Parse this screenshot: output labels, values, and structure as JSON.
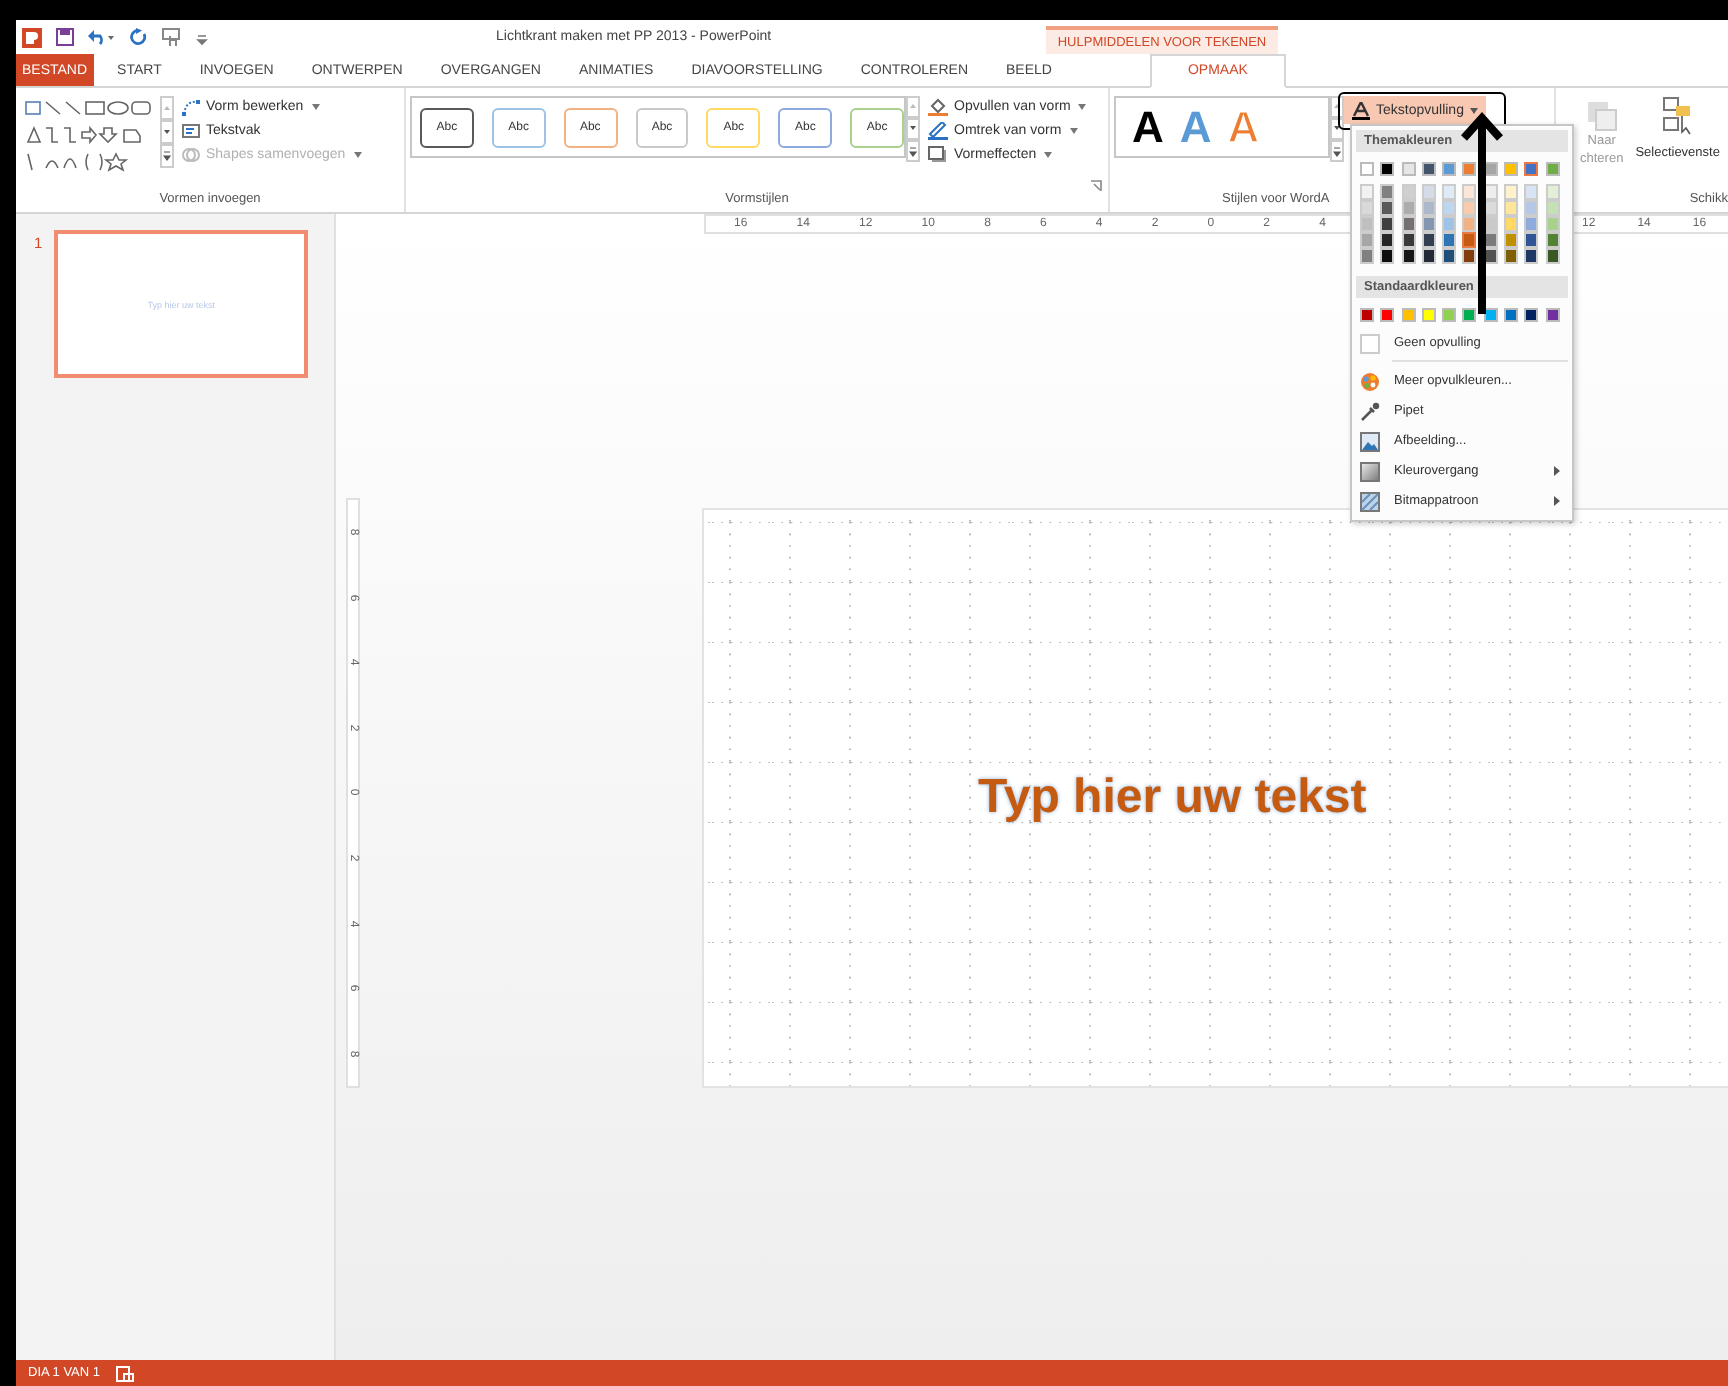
{
  "title_bar": {
    "title": "Lichtkrant maken met PP 2013 - PowerPoint",
    "contextual_header": "HULPMIDDELEN VOOR TEKENEN"
  },
  "tabs": [
    {
      "label": "BESTAND",
      "kind": "file",
      "selected": false
    },
    {
      "label": "START",
      "kind": "normal",
      "selected": false
    },
    {
      "label": "INVOEGEN",
      "kind": "normal",
      "selected": false
    },
    {
      "label": "ONTWERPEN",
      "kind": "normal",
      "selected": false
    },
    {
      "label": "OVERGANGEN",
      "kind": "normal",
      "selected": false
    },
    {
      "label": "ANIMATIES",
      "kind": "normal",
      "selected": false
    },
    {
      "label": "DIAVOORSTELLING",
      "kind": "normal",
      "selected": false
    },
    {
      "label": "CONTROLEREN",
      "kind": "normal",
      "selected": false
    },
    {
      "label": "BEELD",
      "kind": "normal",
      "selected": false
    },
    {
      "label": "OPMAAK",
      "kind": "contextual",
      "selected": true
    }
  ],
  "insert_shapes": {
    "label": "Vormen invoegen",
    "commands": [
      {
        "label": "Vorm bewerken",
        "dropdown": true,
        "disabled": false
      },
      {
        "label": "Tekstvak",
        "dropdown": false,
        "disabled": false
      },
      {
        "label": "Shapes samenvoegen",
        "dropdown": true,
        "disabled": true
      }
    ]
  },
  "shape_styles": {
    "label": "Vormstijlen",
    "styles": [
      {
        "label": "Abc",
        "color": "#595959"
      },
      {
        "label": "Abc",
        "color": "#9dc3e6"
      },
      {
        "label": "Abc",
        "color": "#f4b183"
      },
      {
        "label": "Abc",
        "color": "#c9c9c9"
      },
      {
        "label": "Abc",
        "color": "#ffd966"
      },
      {
        "label": "Abc",
        "color": "#8faadc"
      },
      {
        "label": "Abc",
        "color": "#a9d18e"
      }
    ],
    "commands": [
      {
        "label": "Opvullen van vorm",
        "dropdown": true
      },
      {
        "label": "Omtrek van vorm",
        "dropdown": true
      },
      {
        "label": "Vormeffecten",
        "dropdown": true
      }
    ]
  },
  "wordart_styles": {
    "label": "Stijlen voor WordA",
    "styles": [
      {
        "label": "A",
        "kind": "solid",
        "color": "#000000"
      },
      {
        "label": "A",
        "kind": "solid",
        "color": "#5b9bd5"
      },
      {
        "label": "A",
        "kind": "outline",
        "color": "#ed7d31"
      }
    ],
    "text_fill": {
      "label": "Tekstopvulling",
      "pressed": true,
      "highlighted": true
    }
  },
  "arrange": {
    "label": "Schikk",
    "send_backward": {
      "top": "Naar",
      "bottom": "chteren"
    },
    "selection_pane": {
      "label": "Selectievenste"
    }
  },
  "fill_menu": {
    "theme_heading": "Themakleuren",
    "theme_colors": [
      {
        "color": "#ffffff",
        "selected": false,
        "shades": [
          {
            "color": "#f2f2f2",
            "selected": false
          },
          {
            "color": "#d9d9d9",
            "selected": false
          },
          {
            "color": "#bfbfbf",
            "selected": false
          },
          {
            "color": "#a6a6a6",
            "selected": false
          },
          {
            "color": "#808080",
            "selected": false
          }
        ]
      },
      {
        "color": "#000000",
        "selected": false,
        "shades": [
          {
            "color": "#808080",
            "selected": false
          },
          {
            "color": "#595959",
            "selected": false
          },
          {
            "color": "#404040",
            "selected": false
          },
          {
            "color": "#262626",
            "selected": false
          },
          {
            "color": "#0d0d0d",
            "selected": false
          }
        ]
      },
      {
        "color": "#e7e6e6",
        "selected": false,
        "shades": [
          {
            "color": "#d0cece",
            "selected": false
          },
          {
            "color": "#aeabab",
            "selected": false
          },
          {
            "color": "#757070",
            "selected": false
          },
          {
            "color": "#3b3838",
            "selected": false
          },
          {
            "color": "#171616",
            "selected": false
          }
        ]
      },
      {
        "color": "#44546a",
        "selected": false,
        "shades": [
          {
            "color": "#d6dce5",
            "selected": false
          },
          {
            "color": "#adb9ca",
            "selected": false
          },
          {
            "color": "#8497b0",
            "selected": false
          },
          {
            "color": "#333f50",
            "selected": false
          },
          {
            "color": "#222a35",
            "selected": false
          }
        ]
      },
      {
        "color": "#5b9bd5",
        "selected": false,
        "shades": [
          {
            "color": "#deebf7",
            "selected": false
          },
          {
            "color": "#bdd7ee",
            "selected": false
          },
          {
            "color": "#9dc3e6",
            "selected": false
          },
          {
            "color": "#2e75b6",
            "selected": false
          },
          {
            "color": "#1f4e79",
            "selected": false
          }
        ]
      },
      {
        "color": "#ed7d31",
        "selected": false,
        "shades": [
          {
            "color": "#fbe5d6",
            "selected": false
          },
          {
            "color": "#f8cbad",
            "selected": false
          },
          {
            "color": "#f4b183",
            "selected": false
          },
          {
            "color": "#c55a11",
            "selected": true
          },
          {
            "color": "#843c0c",
            "selected": false
          }
        ]
      },
      {
        "color": "#a5a5a5",
        "selected": false,
        "shades": [
          {
            "color": "#ededed",
            "selected": false
          },
          {
            "color": "#dbdbdb",
            "selected": false
          },
          {
            "color": "#c9c9c9",
            "selected": false
          },
          {
            "color": "#7b7b7b",
            "selected": false
          },
          {
            "color": "#525252",
            "selected": false
          }
        ]
      },
      {
        "color": "#ffc000",
        "selected": false,
        "shades": [
          {
            "color": "#fff2cc",
            "selected": false
          },
          {
            "color": "#ffe699",
            "selected": false
          },
          {
            "color": "#ffd966",
            "selected": false
          },
          {
            "color": "#bf9000",
            "selected": false
          },
          {
            "color": "#7f6000",
            "selected": false
          }
        ]
      },
      {
        "color": "#4472c4",
        "selected": true,
        "shades": [
          {
            "color": "#dae3f3",
            "selected": false
          },
          {
            "color": "#b4c7e7",
            "selected": false
          },
          {
            "color": "#8faadc",
            "selected": false
          },
          {
            "color": "#2f5597",
            "selected": false
          },
          {
            "color": "#203864",
            "selected": false
          }
        ]
      },
      {
        "color": "#70ad47",
        "selected": false,
        "shades": [
          {
            "color": "#e2f0d9",
            "selected": false
          },
          {
            "color": "#c5e0b4",
            "selected": false
          },
          {
            "color": "#a9d18e",
            "selected": false
          },
          {
            "color": "#548235",
            "selected": false
          },
          {
            "color": "#385723",
            "selected": false
          }
        ]
      }
    ],
    "standard_heading": "Standaardkleuren",
    "standard_colors": [
      {
        "color": "#c00000",
        "selected": false
      },
      {
        "color": "#ff0000",
        "selected": false
      },
      {
        "color": "#ffc000",
        "selected": false
      },
      {
        "color": "#ffff00",
        "selected": false
      },
      {
        "color": "#92d050",
        "selected": false
      },
      {
        "color": "#00b050",
        "selected": false
      },
      {
        "color": "#00b0f0",
        "selected": false
      },
      {
        "color": "#0070c0",
        "selected": false
      },
      {
        "color": "#002060",
        "selected": false
      },
      {
        "color": "#7030a0",
        "selected": false
      }
    ],
    "items": [
      {
        "label": "Geen opvulling",
        "kind": "none",
        "submenu": false
      },
      {
        "label": "Meer opvulkleuren...",
        "kind": "palette",
        "submenu": false
      },
      {
        "label": "Pipet",
        "kind": "eyedropper",
        "submenu": false
      },
      {
        "label": "Afbeelding...",
        "kind": "picture",
        "submenu": false
      },
      {
        "label": "Kleurovergang",
        "kind": "gradient",
        "submenu": true
      },
      {
        "label": "Bitmappatroon",
        "kind": "texture",
        "submenu": true
      }
    ]
  },
  "ruler": {
    "left_labels": [
      "16",
      "14",
      "12",
      "10",
      "8",
      "6",
      "4",
      "2",
      "0",
      "2",
      "4"
    ],
    "right_labels": [
      "12",
      "14",
      "16"
    ]
  },
  "vertical_ruler": {
    "labels": [
      "8",
      "6",
      "4",
      "2",
      "0",
      "2",
      "4",
      "6",
      "8"
    ]
  },
  "thumbnails": [
    {
      "number": "1",
      "text": "Typ hier uw tekst",
      "selected": true
    }
  ],
  "slide": {
    "text": "Typ hier uw tekst"
  },
  "status_bar": {
    "slide_info": "DIA 1 VAN 1"
  }
}
